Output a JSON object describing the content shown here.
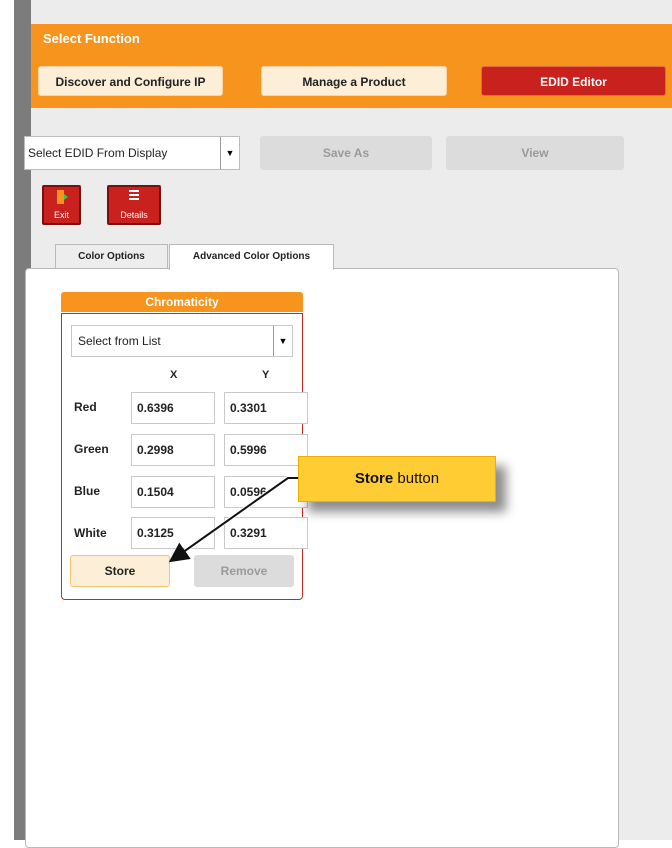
{
  "header": {
    "title": "Select Function",
    "buttons": {
      "discover": "Discover and Configure IP",
      "manage": "Manage a Product",
      "edid": "EDID Editor"
    }
  },
  "toolbar": {
    "edid_source": "Select EDID From Display",
    "save_as": "Save As",
    "view": "View",
    "exit": "Exit",
    "details": "Details"
  },
  "tabs": {
    "color_options": "Color Options",
    "advanced_color_options": "Advanced Color Options"
  },
  "chromaticity": {
    "title": "Chromaticity",
    "list_select": "Select from List",
    "col_x": "X",
    "col_y": "Y",
    "rows": [
      {
        "label": "Red",
        "x": "0.6396",
        "y": "0.3301"
      },
      {
        "label": "Green",
        "x": "0.2998",
        "y": "0.5996"
      },
      {
        "label": "Blue",
        "x": "0.1504",
        "y": "0.0596"
      },
      {
        "label": "White",
        "x": "0.3125",
        "y": "0.3291"
      }
    ],
    "store": "Store",
    "remove": "Remove"
  },
  "callout": {
    "bold": "Store",
    "rest": " button"
  },
  "colors": {
    "accent_orange": "#f7941d",
    "edid_red": "#c9211e",
    "callout_yellow": "#ffcc33"
  },
  "icons": {
    "exit": "exit-door-icon",
    "details": "details-list-icon",
    "dropdown": "triangle-down-icon"
  }
}
